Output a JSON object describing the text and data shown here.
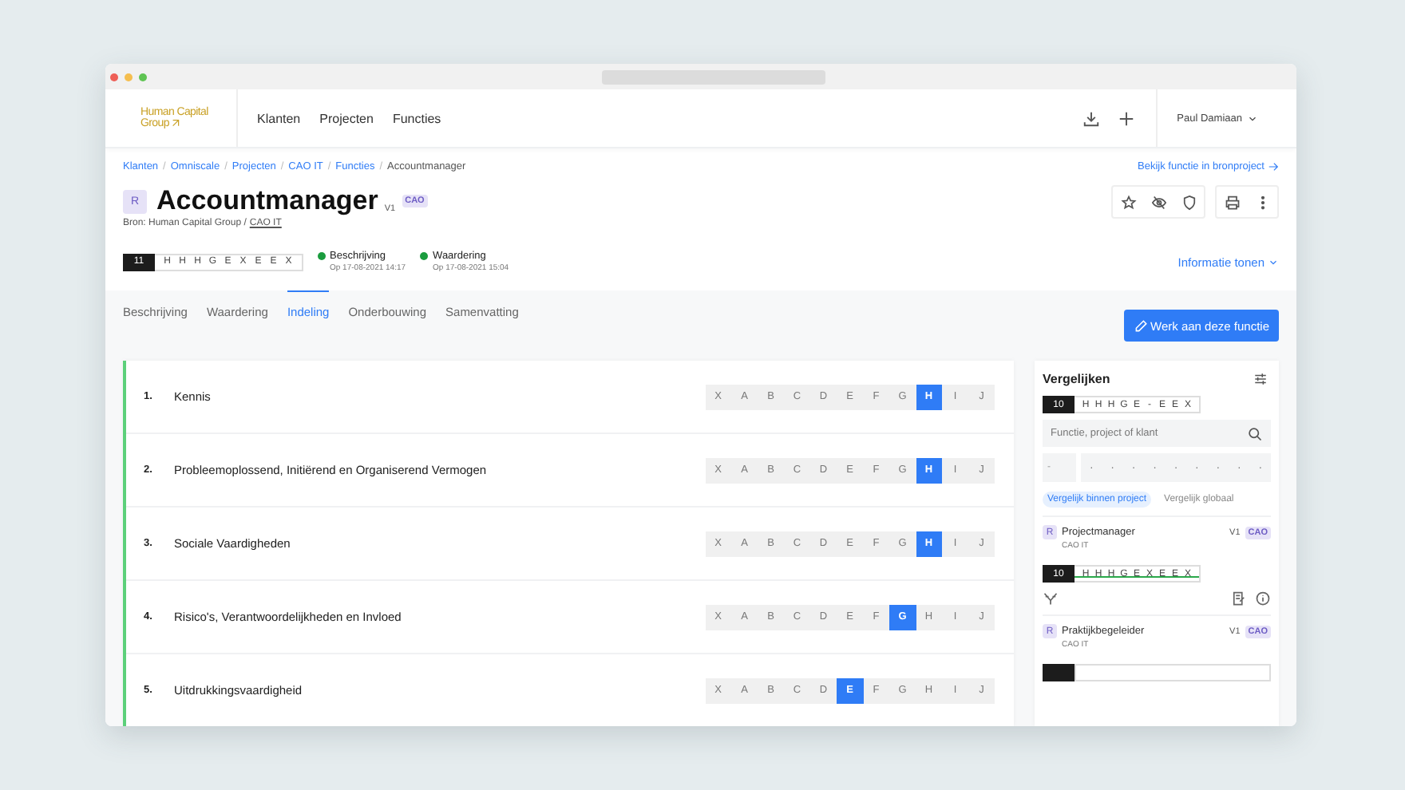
{
  "header": {
    "logo": {
      "line_1": "Human Capital",
      "line_2": "Group"
    },
    "nav": [
      {
        "label": "Klanten"
      },
      {
        "label": "Projecten"
      },
      {
        "label": "Functies"
      }
    ],
    "user": "Paul Damiaan"
  },
  "breadcrumb": {
    "items": [
      {
        "label": "Klanten",
        "current": false
      },
      {
        "label": "Omniscale",
        "current": false
      },
      {
        "label": "Projecten",
        "current": false
      },
      {
        "label": "CAO IT",
        "current": false
      },
      {
        "label": "Functies",
        "current": false
      },
      {
        "label": "Accountmanager",
        "current": true
      }
    ],
    "separator": "/",
    "link": "Bekijk functie in bronproject"
  },
  "title": {
    "badge": "R",
    "name": "Accountmanager",
    "version": "V1",
    "tag": "CAO",
    "source": "Bron: Human Capital Group /",
    "source_link": "CAO IT"
  },
  "code": {
    "score": "11",
    "letters": [
      "H",
      "H",
      "H",
      "G",
      "E",
      "X",
      "E",
      "E",
      "X"
    ]
  },
  "statuses": [
    {
      "label": "Beschrijving",
      "date": "Op 17-08-2021 14:17",
      "color": "#1a9c3e"
    },
    {
      "label": "Waardering",
      "date": "Op 17-08-2021 15:04",
      "color": "#1a9c3e"
    }
  ],
  "info_toggle": "Informatie tonen",
  "tabs": [
    {
      "label": "Beschrijving",
      "selected": false
    },
    {
      "label": "Waardering",
      "selected": false
    },
    {
      "label": "Indeling",
      "selected": true
    },
    {
      "label": "Onderbouwing",
      "selected": false
    },
    {
      "label": "Samenvatting",
      "selected": false
    }
  ],
  "action_button": "Werk aan deze functie",
  "criteria": [
    {
      "number": "1.",
      "name": "Kennis",
      "options": [
        {
          "label": "X",
          "selected": false
        },
        {
          "label": "A",
          "selected": false
        },
        {
          "label": "B",
          "selected": false
        },
        {
          "label": "C",
          "selected": false
        },
        {
          "label": "D",
          "selected": false
        },
        {
          "label": "E",
          "selected": false
        },
        {
          "label": "F",
          "selected": false
        },
        {
          "label": "G",
          "selected": false
        },
        {
          "label": "H",
          "selected": true
        },
        {
          "label": "I",
          "selected": false
        },
        {
          "label": "J",
          "selected": false
        }
      ]
    },
    {
      "number": "2.",
      "name": "Probleemoplossend, Initiërend en Organiserend Vermogen",
      "options": [
        {
          "label": "X",
          "selected": false
        },
        {
          "label": "A",
          "selected": false
        },
        {
          "label": "B",
          "selected": false
        },
        {
          "label": "C",
          "selected": false
        },
        {
          "label": "D",
          "selected": false
        },
        {
          "label": "E",
          "selected": false
        },
        {
          "label": "F",
          "selected": false
        },
        {
          "label": "G",
          "selected": false
        },
        {
          "label": "H",
          "selected": true
        },
        {
          "label": "I",
          "selected": false
        },
        {
          "label": "J",
          "selected": false
        }
      ]
    },
    {
      "number": "3.",
      "name": "Sociale Vaardigheden",
      "options": [
        {
          "label": "X",
          "selected": false
        },
        {
          "label": "A",
          "selected": false
        },
        {
          "label": "B",
          "selected": false
        },
        {
          "label": "C",
          "selected": false
        },
        {
          "label": "D",
          "selected": false
        },
        {
          "label": "E",
          "selected": false
        },
        {
          "label": "F",
          "selected": false
        },
        {
          "label": "G",
          "selected": false
        },
        {
          "label": "H",
          "selected": true
        },
        {
          "label": "I",
          "selected": false
        },
        {
          "label": "J",
          "selected": false
        }
      ]
    },
    {
      "number": "4.",
      "name": "Risico's, Verantwoordelijkheden en Invloed",
      "options": [
        {
          "label": "X",
          "selected": false
        },
        {
          "label": "A",
          "selected": false
        },
        {
          "label": "B",
          "selected": false
        },
        {
          "label": "C",
          "selected": false
        },
        {
          "label": "D",
          "selected": false
        },
        {
          "label": "E",
          "selected": false
        },
        {
          "label": "F",
          "selected": false
        },
        {
          "label": "G",
          "selected": true
        },
        {
          "label": "H",
          "selected": false
        },
        {
          "label": "I",
          "selected": false
        },
        {
          "label": "J",
          "selected": false
        }
      ]
    },
    {
      "number": "5.",
      "name": "Uitdrukkingsvaardigheid",
      "options": [
        {
          "label": "X",
          "selected": false
        },
        {
          "label": "A",
          "selected": false
        },
        {
          "label": "B",
          "selected": false
        },
        {
          "label": "C",
          "selected": false
        },
        {
          "label": "D",
          "selected": false
        },
        {
          "label": "E",
          "selected": true
        },
        {
          "label": "F",
          "selected": false
        },
        {
          "label": "G",
          "selected": false
        },
        {
          "label": "H",
          "selected": false
        },
        {
          "label": "I",
          "selected": false
        },
        {
          "label": "J",
          "selected": false
        }
      ]
    }
  ],
  "compare": {
    "title": "Vergelijken",
    "code": {
      "score": "10",
      "letters": [
        "H",
        "H",
        "H",
        "G",
        "E",
        "-",
        "E",
        "E",
        "X"
      ]
    },
    "search": {
      "placeholder": "Functie, project of klant"
    },
    "filter": {
      "score": "-",
      "letters": [
        "·",
        "·",
        "·",
        "·",
        "·",
        "·",
        "·",
        "·",
        "·"
      ]
    },
    "tabs": [
      {
        "label": "Vergelijk binnen project",
        "selected": true
      },
      {
        "label": "Vergelijk globaal",
        "selected": false
      }
    ],
    "results": [
      {
        "badge": "R",
        "name": "Projectmanager",
        "project": "CAO IT",
        "version": "V1",
        "tag": "CAO",
        "code": {
          "score": "10",
          "letters": [
            "H",
            "H",
            "H",
            "G",
            "E",
            "X",
            "E",
            "E",
            "X"
          ],
          "match": true
        }
      },
      {
        "badge": "R",
        "name": "Praktijkbegeleider",
        "project": "CAO IT",
        "version": "V1",
        "tag": "CAO"
      }
    ]
  }
}
